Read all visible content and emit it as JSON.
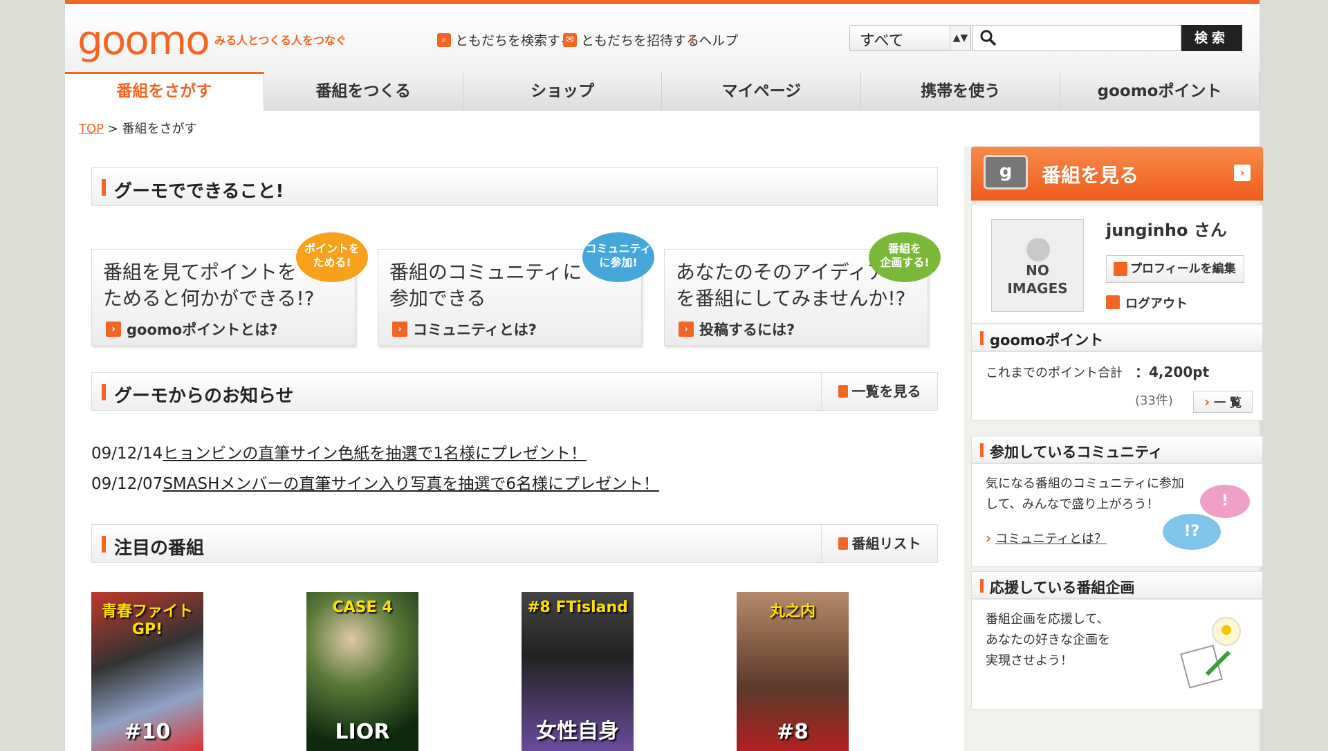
{
  "header": {
    "logo": "goomo",
    "tagline": "みる人とつくる人をつなぐ",
    "links": [
      {
        "label": "ともだちを検索する"
      },
      {
        "label": "ともだちを招待する"
      },
      {
        "label": "ヘルプ"
      }
    ],
    "search": {
      "scope": "すべて",
      "placeholder": "",
      "button": "検索"
    }
  },
  "nav": {
    "tabs": [
      "番組をさがす",
      "番組をつくる",
      "ショップ",
      "マイページ",
      "携帯を使う",
      "goomoポイント"
    ],
    "active_index": 0
  },
  "breadcrumb": {
    "top": "TOP",
    "sep": ">",
    "current": "番組をさがす"
  },
  "main": {
    "features_title": "グーモでできること!",
    "cards": [
      {
        "text1": "番組を見てポイントを",
        "text2": "ためると何かができる!?",
        "link": "goomoポイントとは?",
        "bubble1": "ポイントを",
        "bubble2": "ためる!"
      },
      {
        "text1": "番組のコミュニティに",
        "text2": "参加できる",
        "link": "コミュニティとは?",
        "bubble1": "コミュニティ",
        "bubble2": "に参加!"
      },
      {
        "text1": "あなたのそのアイディア",
        "text2": "を番組にしてみませんか!?",
        "link": "投稿するには?",
        "bubble1": "番組を",
        "bubble2": "企画する!"
      }
    ],
    "news_title": "グーモからのお知らせ",
    "news_link": "一覧を見る",
    "news": [
      {
        "date": "09/12/14",
        "text": "ヒョンビンの直筆サイン色紙を抽選で1名様にプレゼント！"
      },
      {
        "date": "09/12/07",
        "text": "SMASHメンバーの直筆サイン入り写真を抽選で6名様にプレゼント！"
      }
    ],
    "programs_title": "注目の番組",
    "programs_link": "番組リスト",
    "programs": [
      {
        "top": "青春ファイトGP!",
        "label": "#10"
      },
      {
        "top": "CASE 4",
        "label": "LIOR"
      },
      {
        "top": "#8 FTisland",
        "label": "女性自身"
      },
      {
        "top": "丸之内",
        "label": "#8"
      }
    ]
  },
  "side": {
    "watch_title": "番組を見る",
    "profile": {
      "noimg1": "NO",
      "noimg2": "IMAGES",
      "name": "junginho さん",
      "edit": "プロフィールを編集",
      "logout": "ログアウト"
    },
    "points": {
      "title": "goomoポイント",
      "label": "これまでのポイント合計",
      "value": "：4,200pt",
      "count": "(33件)",
      "list": "一 覧"
    },
    "community": {
      "title": "参加しているコミュニティ",
      "text1": "気になる番組のコミュニティに参加",
      "text2": "して、みんなで盛り上がろう！",
      "link": "コミュニティとは？"
    },
    "support": {
      "title": "応援している番組企画",
      "text1": "番組企画を応援して、",
      "text2": "あなたの好きな企画を",
      "text3": "実現させよう！"
    }
  }
}
